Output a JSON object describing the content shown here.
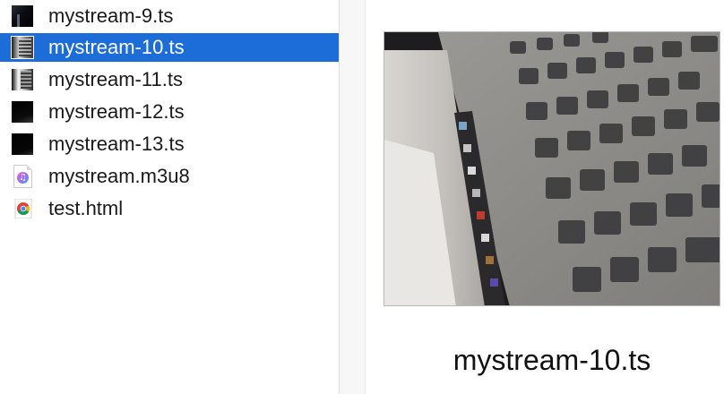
{
  "files": [
    {
      "name": "mystream-9.ts",
      "icon": "video-thumbnail-icon",
      "thumb": "t9",
      "selected": false
    },
    {
      "name": "mystream-10.ts",
      "icon": "video-thumbnail-icon",
      "thumb": "t10",
      "selected": true
    },
    {
      "name": "mystream-11.ts",
      "icon": "video-thumbnail-icon",
      "thumb": "t11",
      "selected": false
    },
    {
      "name": "mystream-12.ts",
      "icon": "video-thumbnail-icon",
      "thumb": "t12",
      "selected": false
    },
    {
      "name": "mystream-13.ts",
      "icon": "video-thumbnail-icon",
      "thumb": "t13",
      "selected": false
    },
    {
      "name": "mystream.m3u8",
      "icon": "playlist-document-icon",
      "thumb": "",
      "selected": false
    },
    {
      "name": "test.html",
      "icon": "chrome-html-icon",
      "thumb": "",
      "selected": false
    }
  ],
  "preview": {
    "caption": "mystream-10.ts",
    "image": "keyboard-video-frame"
  },
  "colors": {
    "selection": "#1c6dd8",
    "selected_text": "#ffffff",
    "text": "#1a1a1a"
  }
}
